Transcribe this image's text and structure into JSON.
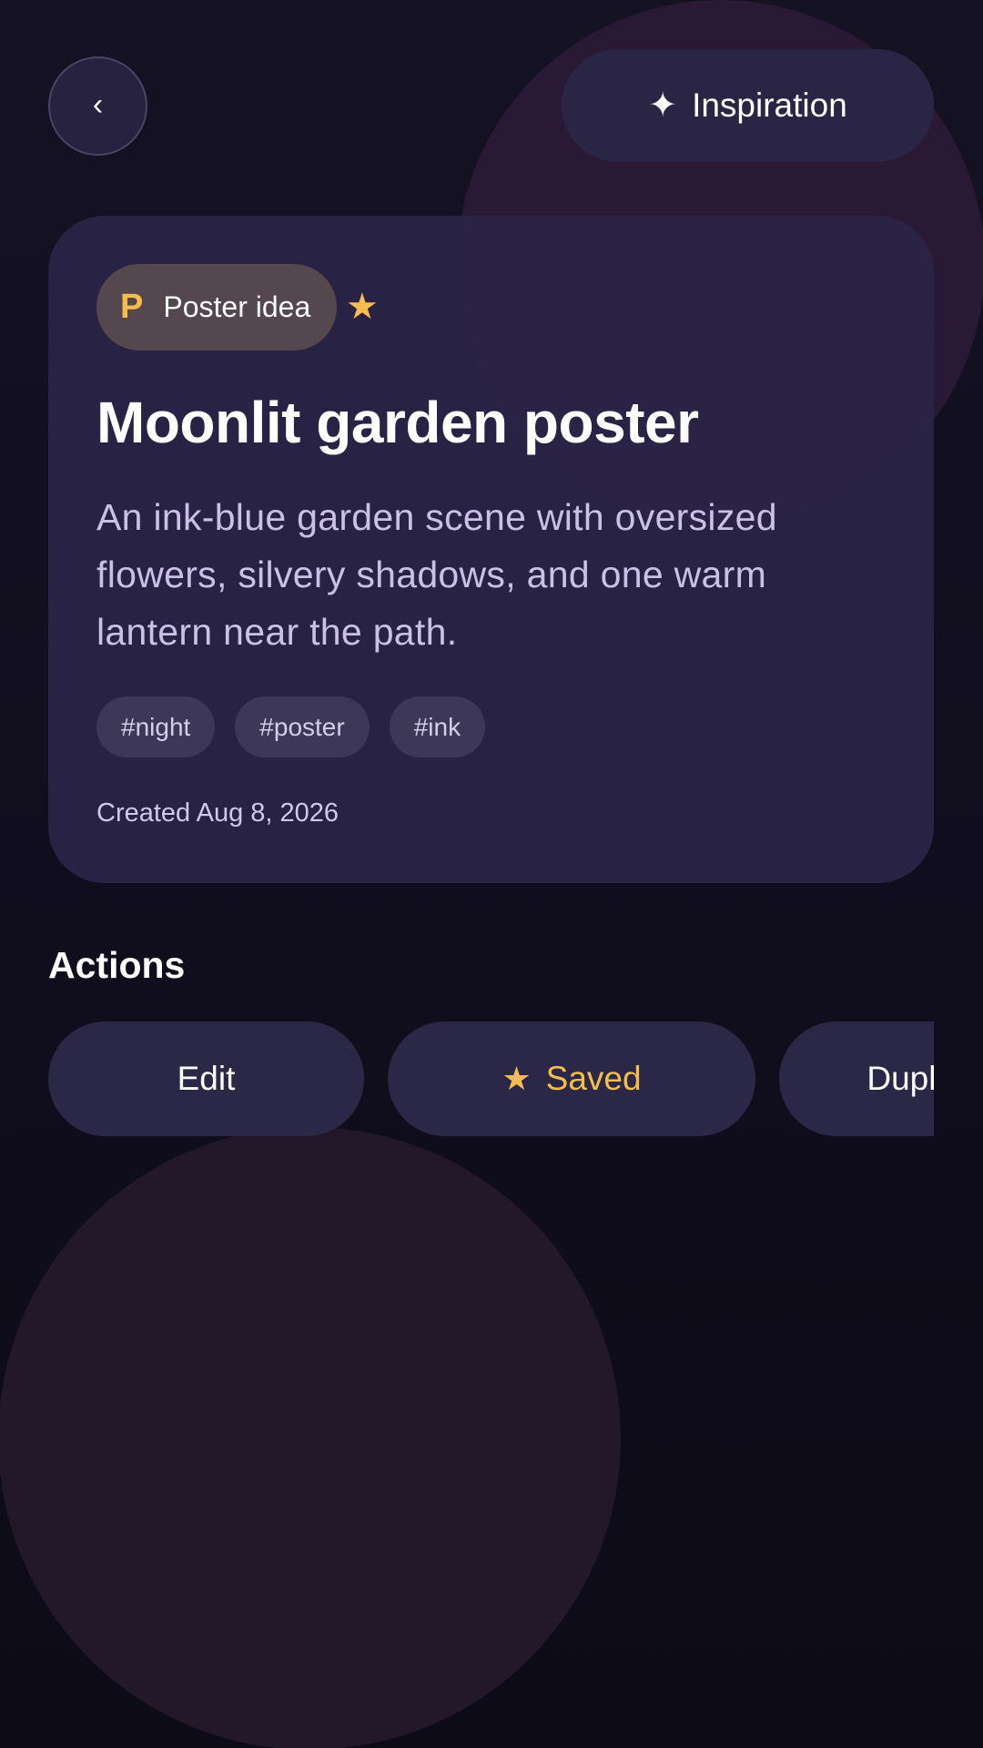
{
  "nav": {
    "back_label": "‹",
    "inspiration_label": "Inspiration",
    "inspiration_icon": "sparkle-icon"
  },
  "idea": {
    "category_letter": "P",
    "category_label": "Poster idea",
    "favorite_icon": "star-icon",
    "title": "Moonlit garden poster",
    "description": "An ink-blue garden scene with oversized flowers, silvery shadows, and one warm lantern near the path.",
    "tags": [
      "#night",
      "#poster",
      "#ink"
    ],
    "created": "Created Aug 8, 2026"
  },
  "actions": {
    "heading": "Actions",
    "edit_label": "Edit",
    "saved_label": "Saved",
    "saved_icon": "star-icon",
    "duplicate_label": "Duplicate"
  },
  "colors": {
    "background": "#12101f",
    "card": "#2a2448",
    "accent_gold": "#f4bd4e",
    "muted_text": "#c9c1e6",
    "badge_bg": "#54474e"
  }
}
